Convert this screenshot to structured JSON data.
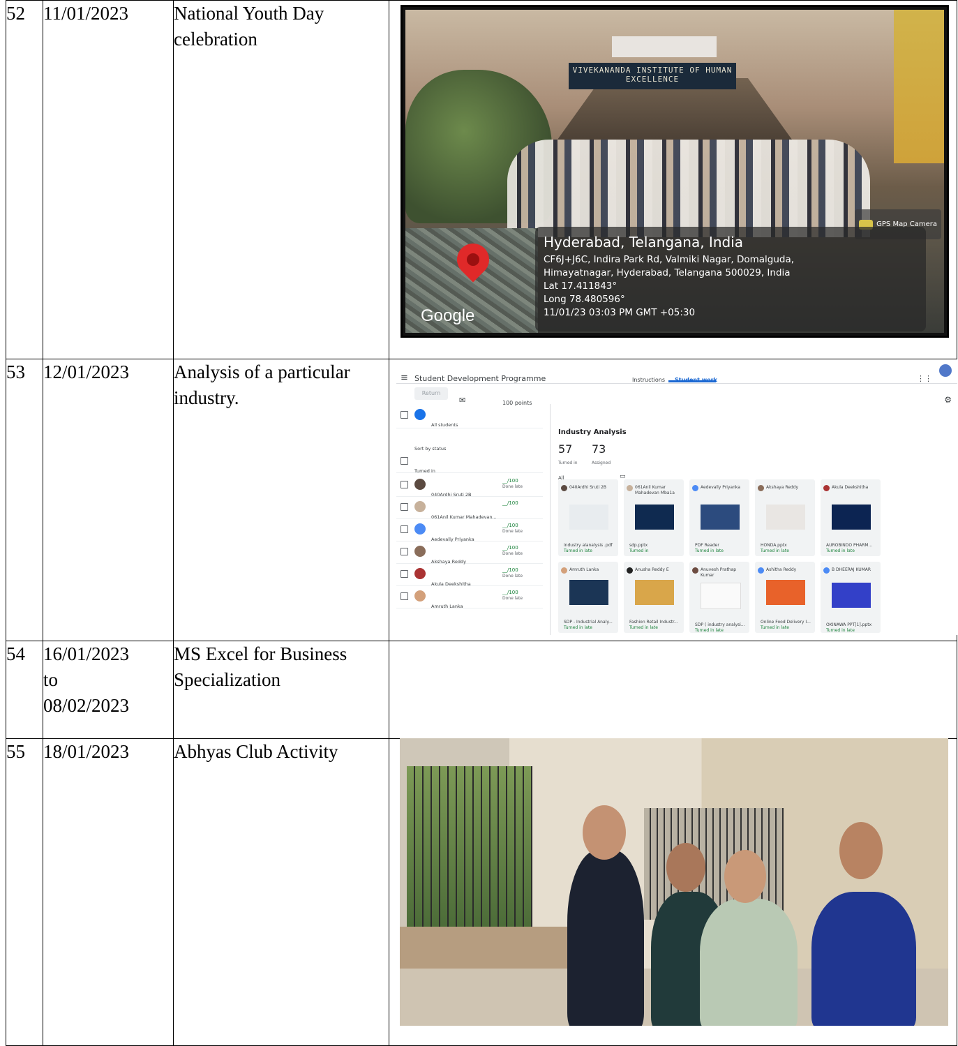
{
  "rows": [
    {
      "sno": "52",
      "date": "11/01/2023",
      "title": "National Youth Day celebration",
      "photo": {
        "sign": "VIVEKANANDA INSTITUTE OF HUMAN EXCELLENCE",
        "gps_app": "GPS Map Camera",
        "map_brand": "Google",
        "location": "Hyderabad, Telangana, India",
        "address_line1": "CF6J+J6C, Indira Park Rd, Valmiki Nagar, Domalguda,",
        "address_line2": "Himayatnagar, Hyderabad, Telangana 500029, India",
        "lat": "Lat 17.411843°",
        "long": "Long 78.480596°",
        "timestamp": "11/01/23 03:03 PM GMT +05:30"
      }
    },
    {
      "sno": "53",
      "date": "12/01/2023",
      "title": "Analysis of a particular industry.",
      "classroom": {
        "course": "Student Development Programme",
        "tab_instructions": "Instructions",
        "tab_student_work": "Student work",
        "return_label": "Return",
        "points": "100 points",
        "all_students": "All students",
        "sort_by": "Sort by status",
        "turned_in_header": "Turned in",
        "assignment": "Industry Analysis",
        "turned_in_count": "57",
        "turned_in_label": "Turned in",
        "assigned_count": "73",
        "assigned_label": "Assigned",
        "filter": "All",
        "students": [
          {
            "name": "040Ardhi Sruti 2B",
            "score": "__/100",
            "status": "Done late"
          },
          {
            "name": "061Anil Kumar Mahadevan...",
            "score": "__/100",
            "status": ""
          },
          {
            "name": "Aedevally Priyanka",
            "score": "__/100",
            "status": "Done late"
          },
          {
            "name": "Akshaya Reddy",
            "score": "__/100",
            "status": "Done late"
          },
          {
            "name": "Akula Deekshitha",
            "score": "__/100",
            "status": "Done late"
          },
          {
            "name": "Amruth Lanka",
            "score": "__/100",
            "status": "Done late"
          }
        ],
        "cards": [
          {
            "name": "040Ardhi Sruti 2B",
            "file": "industry alanalysis .pdf",
            "status": "Turned in late"
          },
          {
            "name": "061Anil Kumar Mahadevan Mba1a",
            "file": "sdp.pptx",
            "status": "Turned in"
          },
          {
            "name": "Aedevally Priyanka",
            "file": "PDF Reader",
            "status": "Turned in late"
          },
          {
            "name": "Akshaya Reddy",
            "file": "HONDA.pptx",
            "status": "Turned in late"
          },
          {
            "name": "Akula Deekshitha",
            "file": "AUROBINDO PHARM...",
            "status": "Turned in late"
          },
          {
            "name": "Amruth Lanka",
            "file": "SDP - Industrial Analy...",
            "status": "Turned in late"
          },
          {
            "name": "Anusha Reddy E",
            "file": "Fashion Retail Industr...",
            "status": "Turned in late"
          },
          {
            "name": "Anuvesh Prathap Kumar",
            "file": "SDP ( industry analysi...",
            "status": "Turned in late"
          },
          {
            "name": "Ashitha Reddy",
            "file": "Online Food Delivery I...",
            "status": "Turned in late"
          },
          {
            "name": "B DHEERAJ KUMAR",
            "file": "OKINAWA PPT[1].pptx",
            "status": "Turned in late"
          }
        ]
      }
    },
    {
      "sno": "54",
      "date_line1": "16/01/2023",
      "date_line2": "to",
      "date_line3": "08/02/2023",
      "title": "MS Excel for Business Specialization"
    },
    {
      "sno": "55",
      "date": "18/01/2023",
      "title": "Abhyas Club Activity"
    }
  ]
}
